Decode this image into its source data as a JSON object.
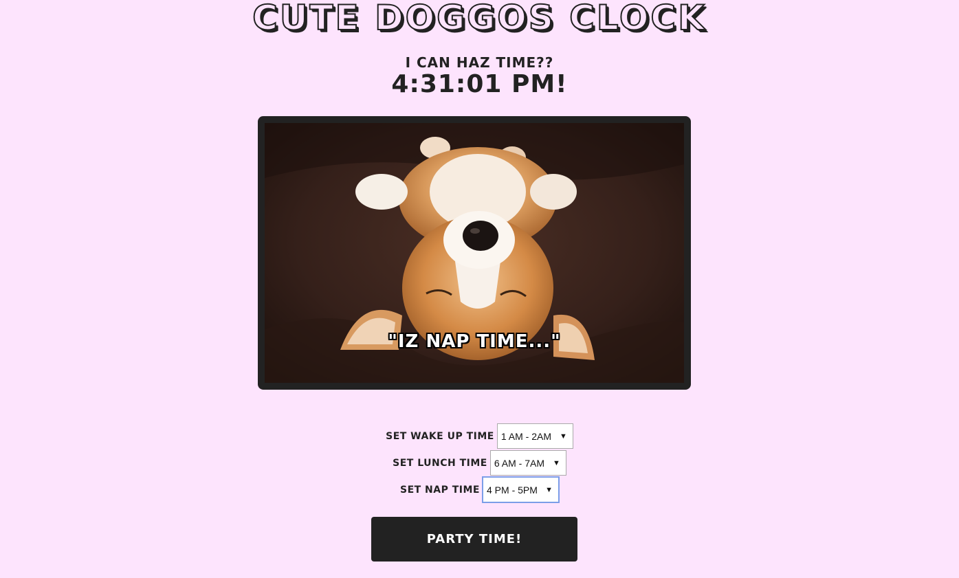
{
  "header": {
    "title": "Cute Doggos Clock",
    "subtitle": "I can haz time??",
    "clock_time": "4:31:01 PM!"
  },
  "image": {
    "caption": "\"IZ NAP TIME...\""
  },
  "settings": {
    "wake_up": {
      "label": "Set Wake Up Time",
      "selected": "1 AM - 2AM"
    },
    "lunch": {
      "label": "Set Lunch Time",
      "selected": "6 AM - 7AM"
    },
    "nap": {
      "label": "Set Nap Time",
      "selected": "4 PM - 5PM"
    }
  },
  "party_button": {
    "label": "Party Time!"
  },
  "colors": {
    "background": "#fde4fd",
    "dark": "#222222",
    "focus_ring": "#7b9de8"
  },
  "icons": {
    "select_arrow": "chevron-down-icon"
  }
}
